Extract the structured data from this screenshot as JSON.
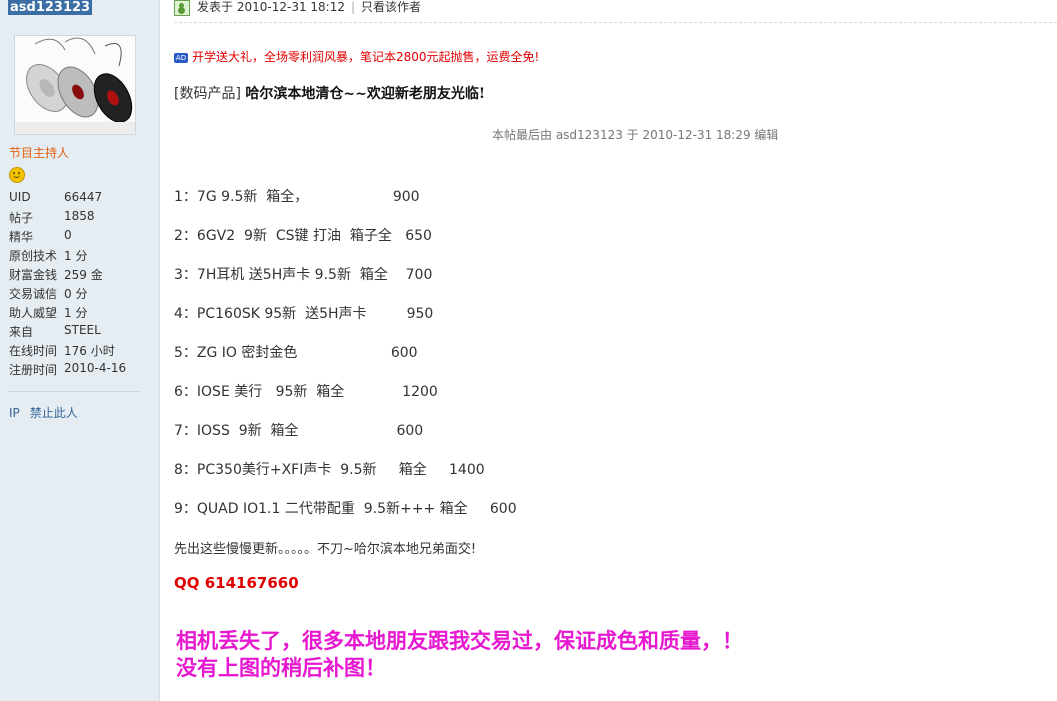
{
  "user": {
    "name": "asd123123",
    "role": "节目主持人",
    "stats": [
      {
        "label": "UID",
        "value": "66447"
      },
      {
        "label": "帖子",
        "value": "1858"
      },
      {
        "label": "精华",
        "value": "0"
      },
      {
        "label": "原创技术",
        "value": "1 分"
      },
      {
        "label": "财富金钱",
        "value": "259 金"
      },
      {
        "label": "交易诚信",
        "value": "0 分"
      },
      {
        "label": "助人威望",
        "value": "1 分"
      },
      {
        "label": "来自",
        "value": "STEEL"
      },
      {
        "label": "在线时间",
        "value": "176 小时"
      },
      {
        "label": "注册时间",
        "value": "2010-4-16"
      }
    ],
    "links": {
      "ip": "IP",
      "ban": "禁止此人"
    }
  },
  "post": {
    "posted_label": "发表于",
    "posted_at": "2010-12-31 18:12",
    "only_author": "只看该作者",
    "ad_badge": "AD",
    "ad_text": "开学送大礼，全场零利润风暴，笔记本2800元起抛售，运费全免!",
    "category": "[数码产品]",
    "title": "哈尔滨本地清仓~~欢迎新老朋友光临!",
    "edit_note": "本帖最后由  asd123123 于  2010-12-31 18:29 编辑",
    "items": [
      "1：7G 9.5新  箱全，                   900",
      "2：6GV2  9新  CS键 打油  箱子全   650",
      "3：7H耳机 送5H声卡 9.5新  箱全    700",
      "4：PC160SK 95新  送5H声卡         950",
      "5：ZG IO 密封金色                     600",
      "6：IOSE 美行   95新  箱全             1200",
      "7：IOSS  9新  箱全                      600",
      "8：PC350美行+XFI声卡  9.5新     箱全     1400",
      "9：QUAD IO1.1 二代带配重  9.5新+++ 箱全     600"
    ],
    "notice": "先出这些慢慢更新。。。。。不刀~哈尔滨本地兄弟面交!",
    "qq": "QQ 614167660",
    "big_line_1": "相机丢失了，很多本地朋友跟我交易过，保证成色和质量，！",
    "big_line_2": "没有上图的稍后补图！"
  }
}
